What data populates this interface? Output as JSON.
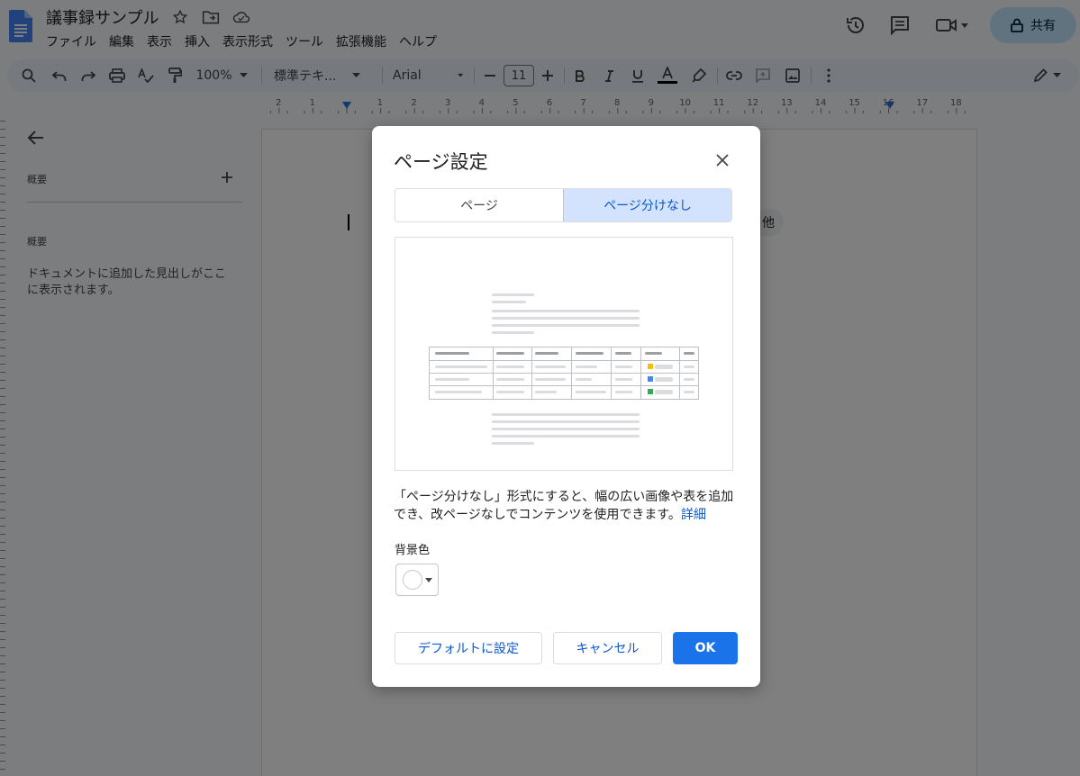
{
  "doc": {
    "title": "議事録サンプル"
  },
  "menu": [
    "ファイル",
    "編集",
    "表示",
    "挿入",
    "表示形式",
    "ツール",
    "拡張機能",
    "ヘルプ"
  ],
  "header": {
    "share_label": "共有"
  },
  "toolbar": {
    "zoom": "100%",
    "style": "標準テキ...",
    "font": "Arial",
    "font_size": "11"
  },
  "ruler": {
    "numbers": [
      "2",
      "1",
      "",
      "1",
      "2",
      "3",
      "4",
      "5",
      "6",
      "7",
      "8",
      "9",
      "10",
      "11",
      "12",
      "13",
      "14",
      "15",
      "16",
      "17",
      "18"
    ]
  },
  "outline": {
    "summary_header": "概要",
    "outline_header": "概要",
    "description": "ドキュメントに追加した見出しがここに表示されます。"
  },
  "page": {
    "chip_text": "他"
  },
  "dialog": {
    "title": "ページ設定",
    "tabs": [
      "ページ",
      "ページ分けなし"
    ],
    "active_tab": "ページ分けなし",
    "description": "「ページ分けなし」形式にすると、幅の広い画像や表を追加でき、改ページなしでコンテンツを使用できます。",
    "learn_more": "詳細",
    "bg_color_label": "背景色",
    "bg_color": "#ffffff",
    "buttons": {
      "default": "デフォルトに設定",
      "cancel": "キャンセル",
      "ok": "OK"
    }
  },
  "colors": {
    "accent": "#1a73e8",
    "share_bg": "#c2e7ff",
    "active_tab_bg": "#d3e3fd"
  }
}
